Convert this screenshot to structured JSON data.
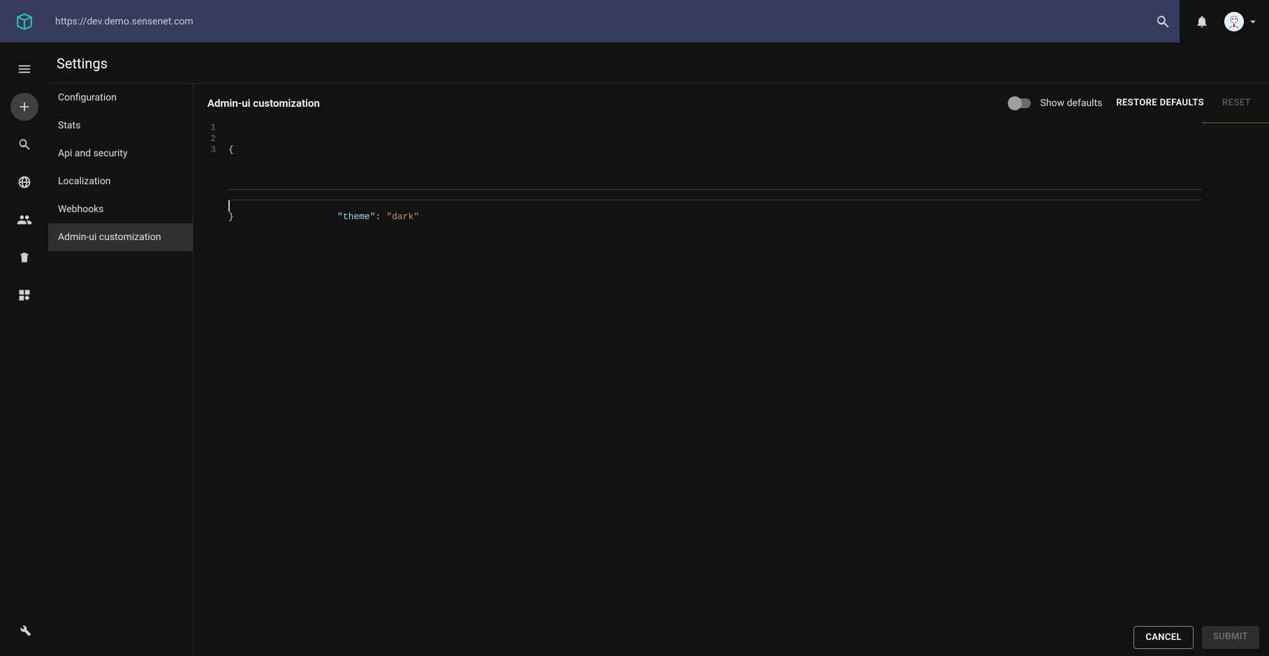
{
  "topbar": {
    "url": "https://dev.demo.sensenet.com"
  },
  "rail": {
    "menu": "menu",
    "add": "add",
    "search": "search",
    "globe": "globe",
    "users": "users",
    "trash": "trash",
    "widgets": "widgets",
    "wrench": "wrench"
  },
  "page": {
    "title": "Settings"
  },
  "settings_sidebar": {
    "items": [
      {
        "label": "Configuration",
        "active": false
      },
      {
        "label": "Stats",
        "active": false
      },
      {
        "label": "Api and security",
        "active": false
      },
      {
        "label": "Localization",
        "active": false
      },
      {
        "label": "Webhooks",
        "active": false
      },
      {
        "label": "Admin-ui customization",
        "active": true
      }
    ]
  },
  "panel": {
    "title": "Admin-ui customization",
    "show_defaults_label": "Show defaults",
    "restore_defaults_label": "RESTORE DEFAULTS",
    "reset_label": "RESET"
  },
  "editor": {
    "lines": {
      "n1": "1",
      "n2": "2",
      "n3": "3",
      "l1_open": "{",
      "l2_indent": "    ",
      "l2_key": "\"theme\"",
      "l2_colon": ": ",
      "l2_val": "\"dark\"",
      "l3_close": "}"
    }
  },
  "footer": {
    "cancel": "CANCEL",
    "submit": "SUBMIT"
  }
}
